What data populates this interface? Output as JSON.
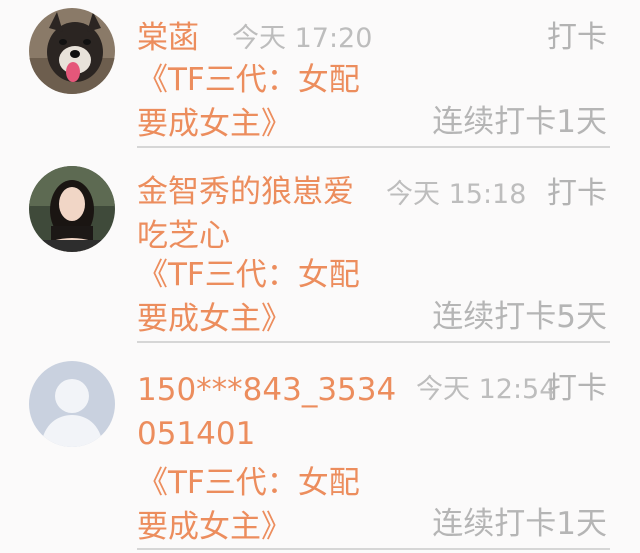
{
  "entries": [
    {
      "user": "棠菡",
      "time": "今天 17:20",
      "action": "打卡",
      "group": "《TF三代：女配要成女主》",
      "streak": "连续打卡1天",
      "avatar": "dog-photo"
    },
    {
      "user": "金智秀的狼崽爱吃芝心",
      "time": "今天 15:18",
      "action": "打卡",
      "group": "《TF三代：女配要成女主》",
      "streak": "连续打卡5天",
      "avatar": "woman-photo"
    },
    {
      "user": "150***843_3534051401",
      "time": "今天 12:54",
      "action": "打卡",
      "group": "《TF三代：女配要成女主》",
      "streak": "连续打卡1天",
      "avatar": "default-user-icon"
    }
  ]
}
